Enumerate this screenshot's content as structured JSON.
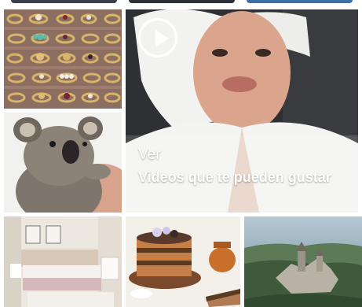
{
  "feed": {
    "video_tile": {
      "icon": "play-icon",
      "action_label": "Ver",
      "caption": "Videos que te pueden gustar"
    },
    "tiles": [
      {
        "subject": "vintage-rings-tray"
      },
      {
        "subject": "baby-koala"
      },
      {
        "subject": "man-in-bathrobe-video"
      },
      {
        "subject": "bedroom-interior"
      },
      {
        "subject": "cake-slices"
      },
      {
        "subject": "aerial-castle"
      }
    ]
  },
  "colors": {
    "overlay_text": "#ffffff",
    "background": "#ffffff"
  }
}
